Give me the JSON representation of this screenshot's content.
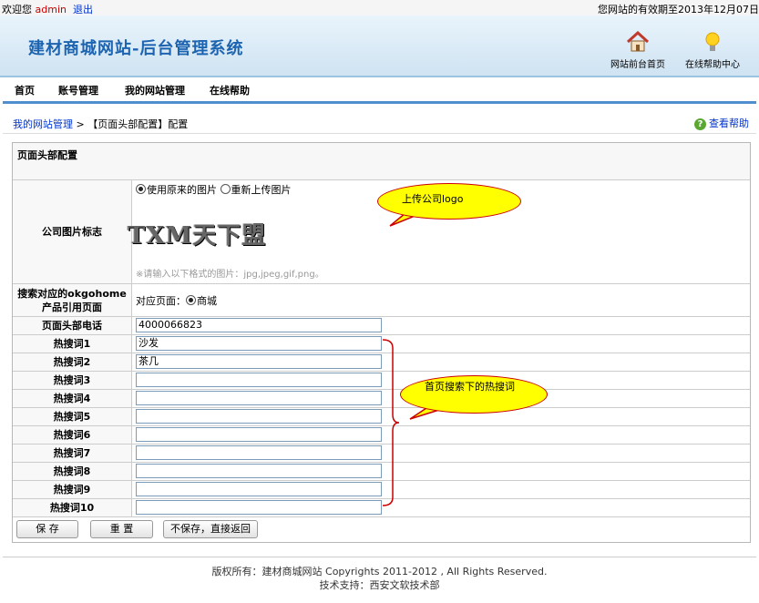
{
  "topbar": {
    "welcome": "欢迎您",
    "user": "admin",
    "logout": "退出",
    "expiry": "您网站的有效期至2013年12月07日"
  },
  "header": {
    "title": "建材商城网站-后台管理系统",
    "home_label": "网站前台首页",
    "help_center_label": "在线帮助中心"
  },
  "nav": [
    "首页",
    "账号管理",
    "我的网站管理",
    "在线帮助"
  ],
  "breadcrumb": {
    "link": "我的网站管理",
    "sep": " > ",
    "current": "【页面头部配置】配置",
    "help": "查看帮助"
  },
  "form": {
    "section_title": "页面头部配置",
    "logo_label": "公司图片标志",
    "radio_keep": "使用原来的图片",
    "radio_upload": "重新上传图片",
    "logo_text": "TXM天下盟",
    "format_note": "※请输入以下格式的图片：jpg,jpeg,gif,png。",
    "search_label": "搜索对应的okgohome产品引用页面",
    "search_page_prefix": "对应页面：",
    "search_page_option": "商城",
    "phone_label": "页面头部电话",
    "phone_value": "4000066823",
    "hotwords": [
      {
        "label": "热搜词1",
        "value": "沙发"
      },
      {
        "label": "热搜词2",
        "value": "茶几"
      },
      {
        "label": "热搜词3",
        "value": ""
      },
      {
        "label": "热搜词4",
        "value": ""
      },
      {
        "label": "热搜词5",
        "value": ""
      },
      {
        "label": "热搜词6",
        "value": ""
      },
      {
        "label": "热搜词7",
        "value": ""
      },
      {
        "label": "热搜词8",
        "value": ""
      },
      {
        "label": "热搜词9",
        "value": ""
      },
      {
        "label": "热搜词10",
        "value": ""
      }
    ]
  },
  "buttons": {
    "save": "保 存",
    "reset": "重 置",
    "back": "不保存，直接返回"
  },
  "annotations": {
    "logo_callout": "上传公司logo",
    "hotword_callout": "首页搜索下的热搜词"
  },
  "footer": {
    "copyright": "版权所有：建材商城网站 Copyrights 2011-2012 , All Rights Reserved.",
    "support": "技术支持：西安文软技术部"
  },
  "colors": {
    "title_blue": "#1d64b0",
    "nav_bar_blue": "#4f8fce",
    "callout_yellow": "#ffff00",
    "callout_border": "#cc0000"
  }
}
